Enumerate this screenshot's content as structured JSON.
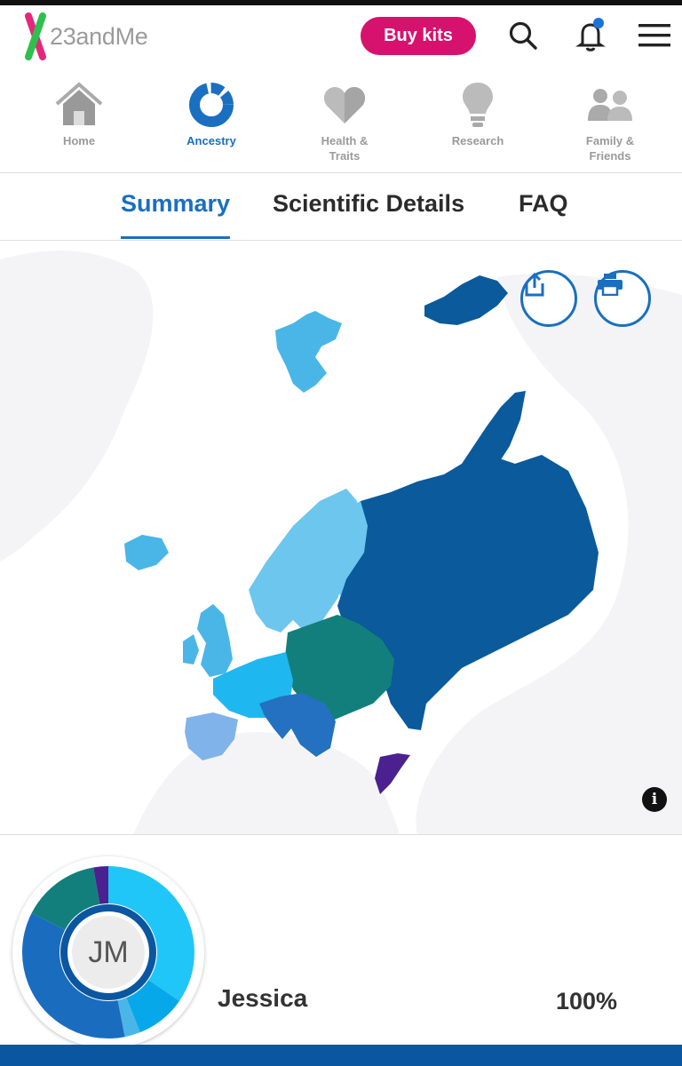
{
  "header": {
    "logo_text": "23andMe",
    "buy_label": "Buy kits",
    "icons": [
      "search-icon",
      "bell-icon",
      "menu-icon"
    ],
    "notification_dot_color": "#1a73d9"
  },
  "nav": [
    {
      "label": "Home",
      "icon": "home-icon",
      "active": false
    },
    {
      "label": "Ancestry",
      "icon": "ancestry-icon",
      "active": true
    },
    {
      "label": "Health & Traits",
      "icon": "heart-icon",
      "active": false
    },
    {
      "label": "Research",
      "icon": "lightbulb-icon",
      "active": false
    },
    {
      "label": "Family & Friends",
      "icon": "people-icon",
      "active": false
    }
  ],
  "tabs": [
    {
      "label": "Summary",
      "active": true
    },
    {
      "label": "Scientific Details",
      "active": false
    },
    {
      "label": "FAQ",
      "active": false
    }
  ],
  "map": {
    "actions": [
      "share-icon",
      "print-icon"
    ],
    "info_label": "i",
    "region_colors": {
      "russia_eastern_europe": "#0a5a9c",
      "central_eastern": "#137f7c",
      "northwest": "#4ab6e8",
      "france_germany": "#1fb7f0",
      "iberia": "#7fb3ea",
      "balkans_italy": "#2371c0",
      "levant": "#4b2190",
      "scandinavia": "#6cc6ee"
    }
  },
  "person": {
    "initials": "JM",
    "name": "Jessica",
    "percent": "100%"
  },
  "colors": {
    "accent": "#1a6fc0",
    "brand_pink": "#d6126e",
    "bottom_bar": "#0b56a0"
  }
}
